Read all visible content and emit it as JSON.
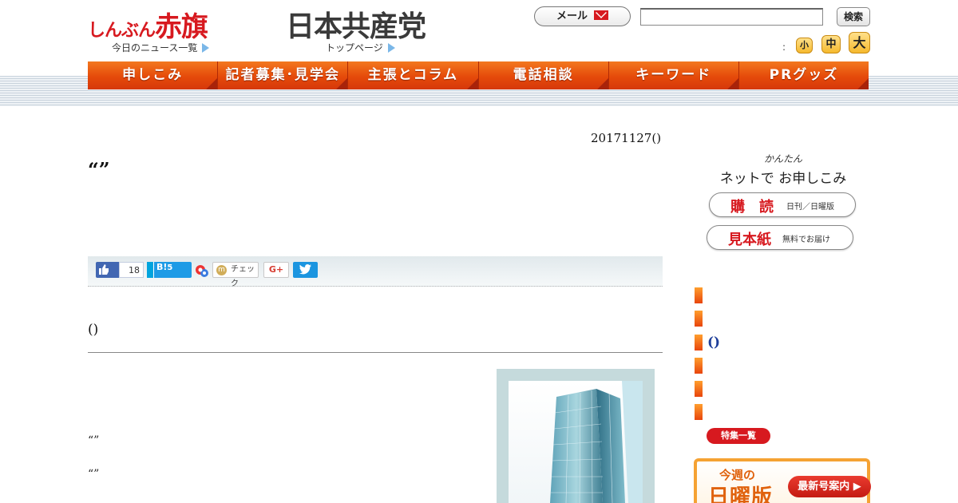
{
  "header": {
    "logo_kana": "しんぶん",
    "logo_kanji": "赤旗",
    "party_logo": "日本共産党",
    "news_list_link": "今日のニュース一覧",
    "top_page_link": "トップページ",
    "mail_button": "メール",
    "search_button": "検索",
    "search_value": "",
    "font_size_colon": ":",
    "font_small": "小",
    "font_medium": "中",
    "font_large": "大"
  },
  "nav": {
    "items": [
      "申しこみ",
      "記者募集･見学会",
      "主張とコラム",
      "電話相談",
      "キーワード",
      "PRグッズ"
    ]
  },
  "article": {
    "date": "20171127()",
    "title": "“”",
    "section_heading": "()",
    "quote_1": "“”",
    "quote_2": "“”"
  },
  "share": {
    "fb_count": "18",
    "hatena_label": "B!",
    "hatena_count": "5",
    "mixi_label": "チェック",
    "gplus_label": "G+"
  },
  "sidebar": {
    "caption_small": "かんたん",
    "caption_big": "ネットで お申しこみ",
    "subscribe_main": "購　読",
    "subscribe_sub": "日刊／日曜版",
    "sample_main": "見本紙",
    "sample_sub": "無料でお届け",
    "features": [
      "",
      "",
      "()",
      "",
      "",
      ""
    ],
    "features_more": "特集一覧",
    "sunday_line1": "今週の",
    "sunday_line2": "日曜版",
    "sunday_button": "最新号案内 ▶"
  },
  "colors": {
    "brand_red": "#d7191f",
    "nav_orange": "#e54a0a",
    "accent_gold": "#f5b92e"
  }
}
